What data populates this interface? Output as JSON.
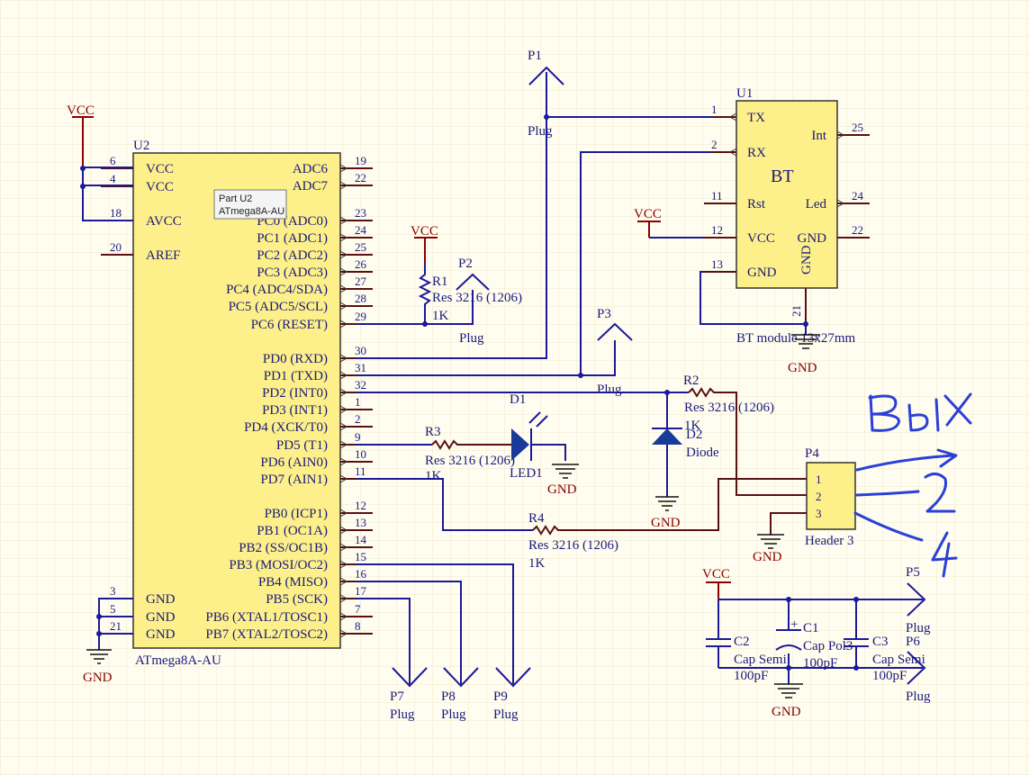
{
  "u2": {
    "ref": "U2",
    "name": "ATmega8A-AU",
    "left_pins": [
      {
        "num": "6",
        "name": "VCC"
      },
      {
        "num": "4",
        "name": "VCC"
      },
      {
        "num": "18",
        "name": "AVCC"
      },
      {
        "num": "20",
        "name": "AREF"
      },
      {
        "num": "3",
        "name": "GND"
      },
      {
        "num": "5",
        "name": "GND"
      },
      {
        "num": "21",
        "name": "GND"
      }
    ],
    "right_pins": [
      {
        "num": "19",
        "name": "ADC6"
      },
      {
        "num": "22",
        "name": "ADC7"
      },
      {
        "num": "23",
        "name": "PC0 (ADC0)"
      },
      {
        "num": "24",
        "name": "PC1 (ADC1)"
      },
      {
        "num": "25",
        "name": "PC2 (ADC2)"
      },
      {
        "num": "26",
        "name": "PC3 (ADC3)"
      },
      {
        "num": "27",
        "name": "PC4 (ADC4/SDA)"
      },
      {
        "num": "28",
        "name": "PC5 (ADC5/SCL)"
      },
      {
        "num": "29",
        "name": "PC6 (RESET)"
      },
      {
        "num": "30",
        "name": "PD0 (RXD)"
      },
      {
        "num": "31",
        "name": "PD1 (TXD)"
      },
      {
        "num": "32",
        "name": "PD2 (INT0)"
      },
      {
        "num": "1",
        "name": "PD3 (INT1)"
      },
      {
        "num": "2",
        "name": "PD4 (XCK/T0)"
      },
      {
        "num": "9",
        "name": "PD5 (T1)"
      },
      {
        "num": "10",
        "name": "PD6 (AIN0)"
      },
      {
        "num": "11",
        "name": "PD7 (AIN1)"
      },
      {
        "num": "12",
        "name": "PB0 (ICP1)"
      },
      {
        "num": "13",
        "name": "PB1 (OC1A)"
      },
      {
        "num": "14",
        "name": "PB2 (SS/OC1B)"
      },
      {
        "num": "15",
        "name": "PB3 (MOSI/OC2)"
      },
      {
        "num": "16",
        "name": "PB4 (MISO)"
      },
      {
        "num": "17",
        "name": "PB5 (SCK)"
      },
      {
        "num": "7",
        "name": "PB6 (XTAL1/TOSC1)"
      },
      {
        "num": "8",
        "name": "PB7 (XTAL2/TOSC2)"
      }
    ]
  },
  "tooltip": {
    "line1": "Part U2",
    "line2": "ATmega8A-AU"
  },
  "u1": {
    "ref": "U1",
    "title": "BT",
    "comment": "BT module 13x27mm",
    "left_pins": [
      {
        "num": "1",
        "name": "TX"
      },
      {
        "num": "2",
        "name": "RX"
      },
      {
        "num": "11",
        "name": "Rst"
      },
      {
        "num": "12",
        "name": "VCC"
      },
      {
        "num": "13",
        "name": "GND"
      }
    ],
    "right_pins": [
      {
        "num": "25",
        "name": "Int"
      },
      {
        "num": "24",
        "name": "Led"
      },
      {
        "num": "22",
        "name": "GND"
      }
    ],
    "bottom_pin": {
      "num": "21",
      "name": "GND"
    }
  },
  "power": {
    "vcc": "VCC",
    "gnd": "GND"
  },
  "ports": {
    "p1": {
      "ref": "P1",
      "type": "Plug"
    },
    "p2": {
      "ref": "P2",
      "type": "Plug"
    },
    "p3": {
      "ref": "P3",
      "type": "Plug"
    },
    "p5": {
      "ref": "P5",
      "type": "Plug"
    },
    "p6": {
      "ref": "P6",
      "type": "Plug"
    },
    "p7": {
      "ref": "P7",
      "type": "Plug"
    },
    "p8": {
      "ref": "P8",
      "type": "Plug"
    },
    "p9": {
      "ref": "P9",
      "type": "Plug"
    }
  },
  "resistors": {
    "r1": {
      "ref": "R1",
      "type": "Res 3216 (1206)",
      "value": "1K"
    },
    "r2": {
      "ref": "R2",
      "type": "Res 3216 (1206)",
      "value": "1K"
    },
    "r3": {
      "ref": "R3",
      "type": "Res 3216 (1206)",
      "value": "1K"
    },
    "r4": {
      "ref": "R4",
      "type": "Res 3216 (1206)",
      "value": "1K"
    }
  },
  "led": {
    "ref": "D1",
    "name": "LED1"
  },
  "diode": {
    "ref": "D2",
    "name": "Diode"
  },
  "header": {
    "ref": "P4",
    "name": "Header 3",
    "pins": [
      "1",
      "2",
      "3"
    ]
  },
  "caps": {
    "c1": {
      "ref": "C1",
      "type": "Cap Pol3",
      "value": "100pF"
    },
    "c2": {
      "ref": "C2",
      "type": "Cap Semi",
      "value": "100pF"
    },
    "c3": {
      "ref": "C3",
      "type": "Cap Semi",
      "value": "100pF"
    }
  },
  "handwriting": {
    "word": "Bыx",
    "digits": [
      "2",
      "4"
    ]
  },
  "colors": {
    "background": "#fffdf0",
    "grid": "#ede6cc",
    "component_fill": "#fdf08a",
    "wire": "#1a1a9a",
    "text": "#1a1a7a",
    "power": "#8b0000",
    "handwriting": "#2b40d8"
  }
}
